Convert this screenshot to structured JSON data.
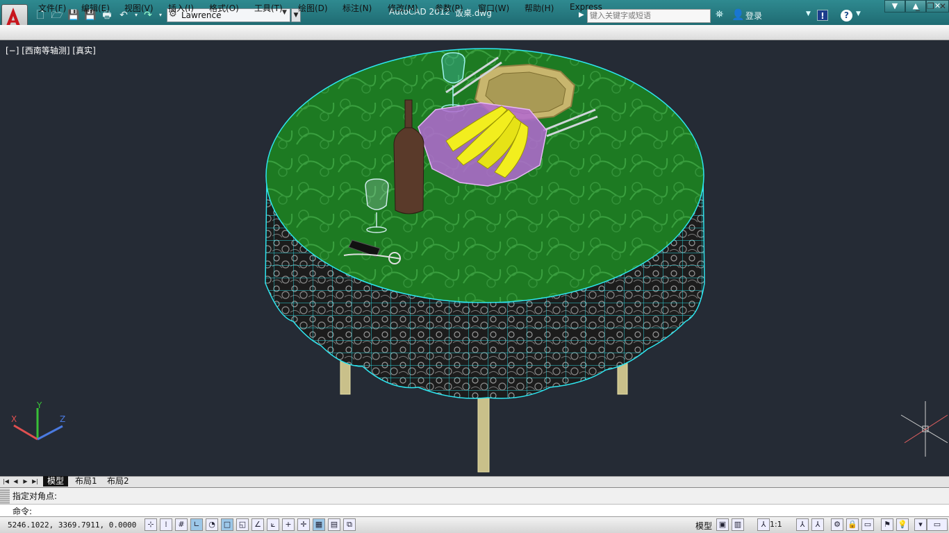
{
  "titlebar": {
    "app_name": "AutoCAD 2012",
    "file_name": "饭桌.dwg",
    "workspace": "Lawrence",
    "search_placeholder": "键入关键字或短语",
    "login_label": "登录",
    "help_label": "?",
    "exchange_label": "!"
  },
  "menu": {
    "items": [
      "文件(F)",
      "编辑(E)",
      "视图(V)",
      "插入(I)",
      "格式(O)",
      "工具(T)",
      "绘图(D)",
      "标注(N)",
      "修改(M)",
      "参数(P)",
      "窗口(W)",
      "帮助(H)",
      "Express"
    ]
  },
  "viewport": {
    "label": "[−] [西南等轴测] [真实]",
    "ucs": {
      "x": "X",
      "y": "Y",
      "z": "Z"
    }
  },
  "tabs": {
    "items": [
      "模型",
      "布局1",
      "布局2"
    ],
    "active": "模型"
  },
  "command": {
    "history": "指定对角点:",
    "prompt": "命令:"
  },
  "status": {
    "coordinates": "5246.1022, 3369.7911, 0.0000",
    "model_label": "模型",
    "scale_label": "1:1"
  },
  "colors": {
    "title_bar": "#1f6b72",
    "viewport_bg": "#252b35",
    "tablecloth_top": "#1d7a22",
    "tablecloth_mesh": "#2ee6f0",
    "banana": "#f2ee1e",
    "bowl": "#b46ad2",
    "plate": "#c8b66e",
    "bottle": "#5a3a2a",
    "table_leg": "#c9c08a"
  },
  "icons": {
    "app_menu": "autocad-logo-icon",
    "new": "new-file-icon",
    "open": "open-folder-icon",
    "save": "save-icon",
    "save_as": "save-as-icon",
    "print": "print-icon",
    "undo": "undo-icon",
    "redo": "redo-icon",
    "workspace": "gear-icon",
    "search": "binoculars-icon",
    "user": "user-icon",
    "help": "help-icon"
  }
}
